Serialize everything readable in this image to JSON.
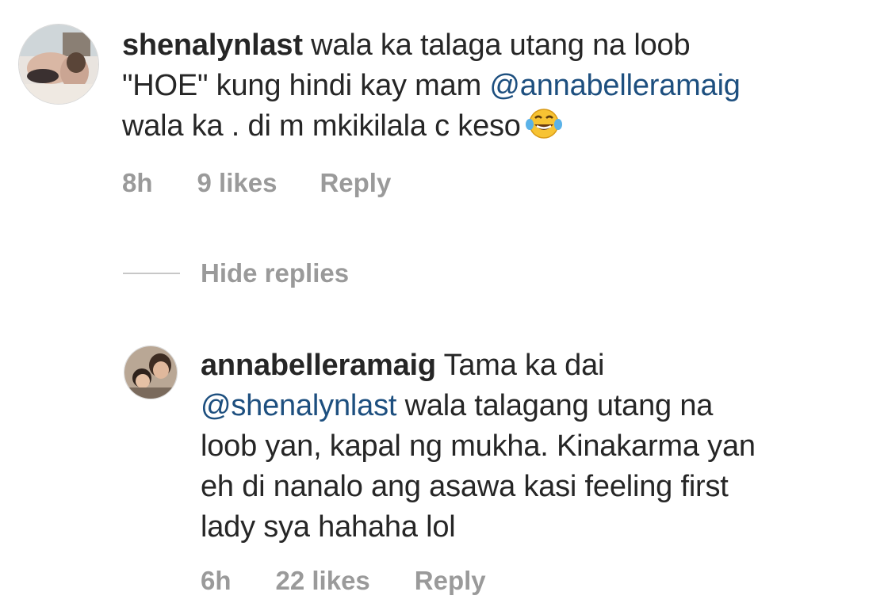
{
  "comments": [
    {
      "username": "shenalynlast",
      "lines": [
        {
          "pre": "wala ka talaga utang na loob"
        },
        {
          "pre": "\"HOE\" kung hindi kay mam ",
          "mention": "@annabelleramaig"
        },
        {
          "pre": "wala ka . di m mkikilala c keso"
        }
      ],
      "emoji": "face-with-tears-of-joy",
      "time": "8h",
      "likes": "9 likes",
      "reply_label": "Reply"
    },
    {
      "username": "annabelleramaig",
      "lines": [
        {
          "pre": "Tama ka dai"
        },
        {
          "mention": "@shenalynlast",
          "post": " wala talagang utang na"
        },
        {
          "pre": "loob yan, kapal ng mukha. Kinakarma yan"
        },
        {
          "pre": "eh di nanalo ang asawa kasi feeling first"
        },
        {
          "pre": "lady sya hahaha lol"
        }
      ],
      "time": "6h",
      "likes": "22 likes",
      "reply_label": "Reply"
    }
  ],
  "hide_replies_label": "Hide replies",
  "colors": {
    "text": "#262626",
    "mention": "#1d4f7f",
    "meta": "#9a9a9a"
  }
}
